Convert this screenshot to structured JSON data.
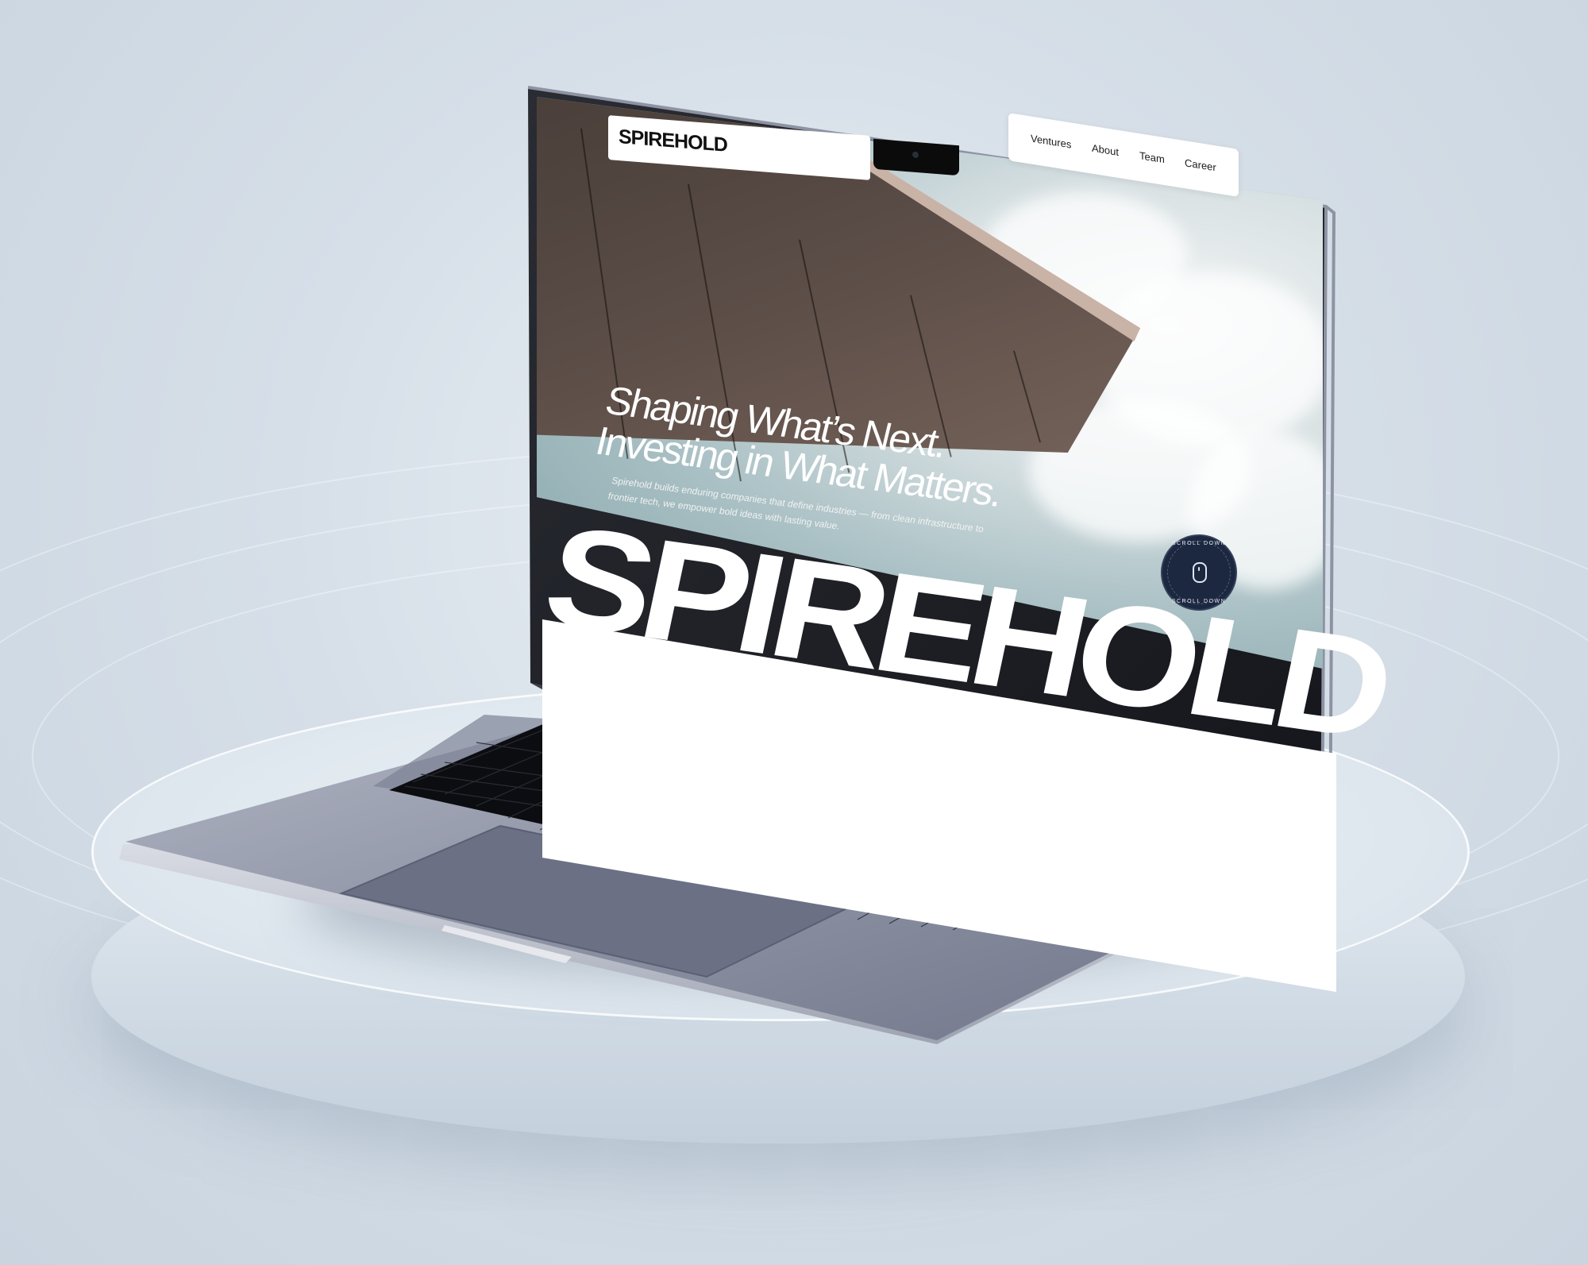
{
  "site": {
    "brand": "SPIREHOLD",
    "nav": {
      "items": [
        {
          "label": "Ventures"
        },
        {
          "label": "About"
        },
        {
          "label": "Team"
        },
        {
          "label": "Career"
        }
      ]
    },
    "hero": {
      "headline_line1": "Shaping What’s Next.",
      "headline_line2": "Investing in What Matters.",
      "description_line1": "Spirehold builds enduring companies that define industries — from clean infrastructure to",
      "description_line2": "frontier tech, we empower bold ideas with lasting value.",
      "big_wordmark": "SPIREHOLD"
    },
    "scroll_badge": {
      "label": "SCROLL DOWN",
      "icon": "mouse-icon"
    }
  },
  "colors": {
    "background": "#d4dee7",
    "nav_bg": "#ffffff",
    "badge_bg": "#1c2740",
    "text_light": "#ffffff",
    "text_dark": "#111111"
  }
}
